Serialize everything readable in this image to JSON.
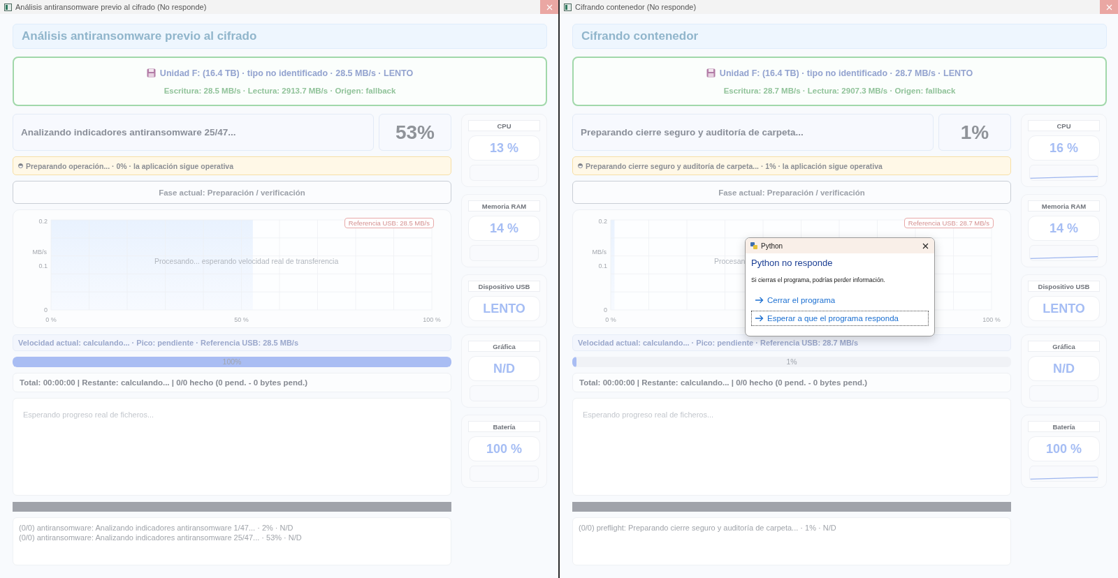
{
  "windows": [
    {
      "title": "Análisis antiransomware previo al cifrado (No responde)",
      "heading": "Análisis antiransomware previo al cifrado",
      "drive": {
        "summary": "Unidad F: (16.4 TB) · tipo no identificado · 28.5 MB/s · LENTO",
        "detail": "Escritura: 28.5 MB/s · Lectura: 2913.7 MB/s · Origen: fallback"
      },
      "task": {
        "label": "Analizando indicadores antiransomware 25/47...",
        "percent": "53%"
      },
      "notice": "Preparando operación... · 0% · la aplicación sigue operativa",
      "phase": "Fase actual: Preparación / verificación",
      "chart": {
        "chart_data": {
          "type": "area",
          "ylabel": "MB/s",
          "xlim": [
            0,
            100
          ],
          "ylim": [
            0,
            0.2
          ],
          "yticks": [
            0,
            0.1,
            0.2
          ],
          "xticks": [
            {
              "value": 0,
              "label": "0 %"
            },
            {
              "value": 50,
              "label": "50 %"
            },
            {
              "value": 100,
              "label": "100 %"
            }
          ]
        },
        "shade": {
          "level": 0.53
        },
        "reference": "Referencia USB: 28.5 MB/s",
        "overlay": "Procesando... esperando velocidad real de transferencia"
      },
      "speed": "Velocidad actual: calculando... · Pico: pendiente · Referencia USB: 28.5 MB/s",
      "progress": {
        "level": 1.0,
        "label": "100%"
      },
      "totals": "Total: 00:00:00 | Restante: calculando... | 0/0 hecho (0 pend. - 0 bytes pend.)",
      "files_placeholder": "Esperando progreso real de ficheros...",
      "log": [
        "(0/0) antiransomware: Analizando indicadores antiransomware 1/47... · 2% · N/D",
        "(0/0) antiransomware: Analizando indicadores antiransomware 25/47... · 53% · N/D"
      ],
      "metrics": [
        {
          "label": "CPU",
          "value": "13 %",
          "kind": "trend",
          "sparkline": false
        },
        {
          "label": "Memoria RAM",
          "value": "14 %",
          "kind": "trend",
          "sparkline": false
        },
        {
          "label": "Dispositivo USB",
          "value": "LENTO",
          "kind": "status"
        },
        {
          "label": "Gráfica",
          "value": "N/D",
          "kind": "trend",
          "sparkline": false
        },
        {
          "label": "Batería",
          "value": "100 %",
          "kind": "trend",
          "sparkline": false
        }
      ]
    },
    {
      "title": "Cifrando contenedor (No responde)",
      "heading": "Cifrando contenedor",
      "drive": {
        "summary": "Unidad F: (16.4 TB) · tipo no identificado · 28.7 MB/s · LENTO",
        "detail": "Escritura: 28.7 MB/s · Lectura: 2907.3 MB/s · Origen: fallback"
      },
      "task": {
        "label": "Preparando cierre seguro y auditoría de carpeta...",
        "percent": "1%"
      },
      "notice": "Preparando cierre seguro y auditoría de carpeta... · 1% · la aplicación sigue operativa",
      "phase": "Fase actual: Preparación / verificación",
      "chart": {
        "chart_data": {
          "type": "area",
          "ylabel": "MB/s",
          "xlim": [
            0,
            100
          ],
          "ylim": [
            0,
            0.2
          ],
          "yticks": [
            0,
            0.1,
            0.2
          ],
          "xticks": [
            {
              "value": 0,
              "label": "0 %"
            },
            {
              "value": 100,
              "label": "100 %"
            }
          ]
        },
        "shade": {
          "level": 0.01
        },
        "reference": "Referencia USB: 28.7 MB/s",
        "overlay": "Procesan"
      },
      "speed": "Velocidad actual: calculando... · Pico: pendiente · Referencia USB: 28.7 MB/s",
      "progress": {
        "level": 0.01,
        "label": "1%"
      },
      "totals": "Total: 00:00:00 | Restante: calculando... | 0/0 hecho (0 pend. - 0 bytes pend.)",
      "files_placeholder": "Esperando progreso real de ficheros...",
      "log": [
        "(0/0) preflight: Preparando cierre seguro y auditoría de carpeta... · 1% · N/D"
      ],
      "metrics": [
        {
          "label": "CPU",
          "value": "16 %",
          "kind": "trend",
          "sparkline": true
        },
        {
          "label": "Memoria RAM",
          "value": "14 %",
          "kind": "trend",
          "sparkline": true
        },
        {
          "label": "Dispositivo USB",
          "value": "LENTO",
          "kind": "status"
        },
        {
          "label": "Gráfica",
          "value": "N/D",
          "kind": "trend",
          "sparkline": false
        },
        {
          "label": "Batería",
          "value": "100 %",
          "kind": "trend",
          "sparkline": true
        }
      ],
      "dialog": {
        "title": "Python",
        "heading": "Python no responde",
        "message": "Si cierras el programa, podrías perder información.",
        "options": [
          {
            "label": "Cerrar el programa",
            "focused": false
          },
          {
            "label": "Esperar a que el programa responda",
            "focused": true
          }
        ]
      }
    }
  ]
}
